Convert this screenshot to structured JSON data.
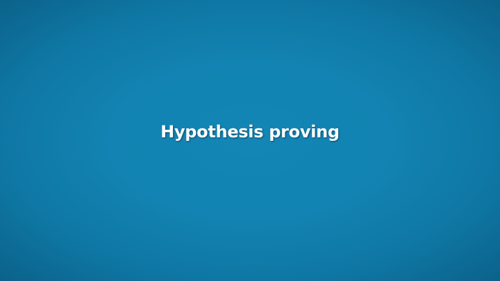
{
  "slide": {
    "title": "Hypothesis proving",
    "background_color": "#1283b2",
    "edge_color": "#0b628a",
    "title_color": "#ffffff"
  }
}
